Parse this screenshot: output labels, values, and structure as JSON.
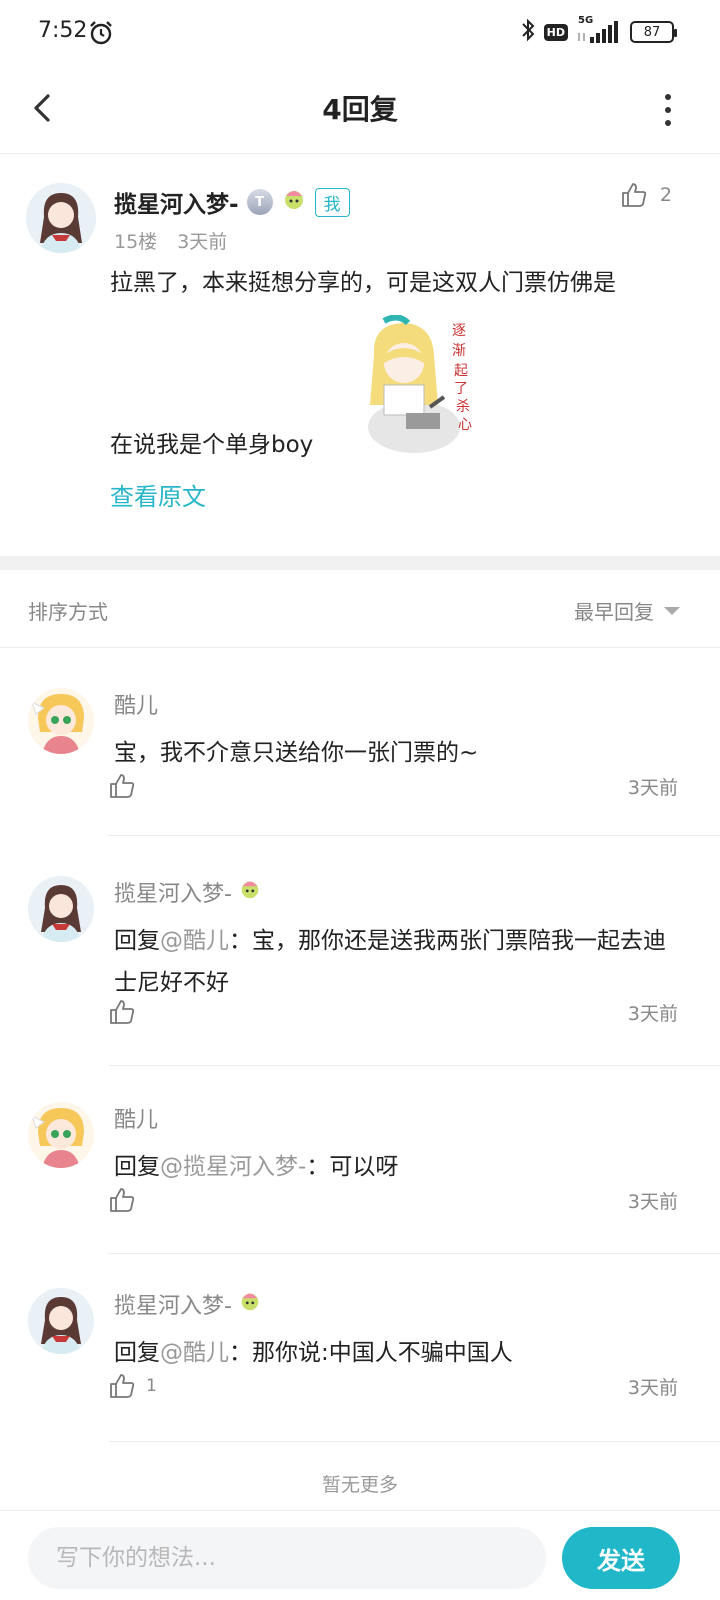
{
  "status_bar": {
    "time": "7:52",
    "hd": "HD",
    "network": "5G",
    "battery": "87"
  },
  "header": {
    "title": "4回复"
  },
  "post": {
    "author": "揽星河入梦-",
    "badge_t": "T",
    "badge_me": "我",
    "floor": "15楼",
    "time": "3天前",
    "likes": "2",
    "text_line1": "拉黑了，本来挺想分享的，可是这双人门票仿佛是",
    "text_line2": "在说我是个单身boy",
    "view_original": "查看原文"
  },
  "sort": {
    "label": "排序方式",
    "selected": "最早回复"
  },
  "replies": [
    {
      "author": "酷儿",
      "prefix": "",
      "mention": "",
      "text": "宝，我不介意只送给你一张门票的~",
      "likes": "",
      "time": "3天前"
    },
    {
      "author": "揽星河入梦-",
      "prefix": "回复",
      "mention": "@酷儿",
      "text": "：宝，那你还是送我两张门票陪我一起去迪士尼好不好",
      "likes": "",
      "time": "3天前"
    },
    {
      "author": "酷儿",
      "prefix": "回复",
      "mention": "@揽星河入梦-",
      "text": "：可以呀",
      "likes": "",
      "time": "3天前"
    },
    {
      "author": "揽星河入梦-",
      "prefix": "回复",
      "mention": "@酷儿",
      "text": "：那你说:中国人不骗中国人",
      "likes": "1",
      "time": "3天前"
    }
  ],
  "no_more": "暂无更多",
  "composer": {
    "placeholder": "写下你的想法...",
    "send_label": "发送"
  },
  "colors": {
    "accent": "#20b7c9",
    "divider": "#ececec"
  }
}
